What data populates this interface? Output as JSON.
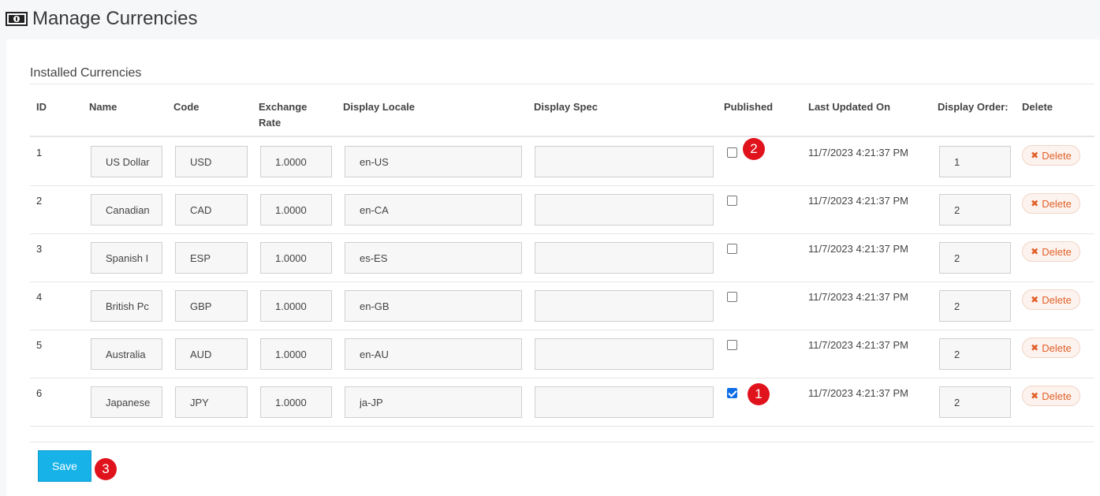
{
  "header": {
    "title": "Manage Currencies",
    "icon": "money-bill-icon"
  },
  "section": {
    "title": "Installed Currencies"
  },
  "columns": {
    "id": "ID",
    "name": "Name",
    "code": "Code",
    "rate_line1": "Exchange",
    "rate_line2": "Rate",
    "locale": "Display Locale",
    "spec": "Display Spec",
    "published": "Published",
    "updated": "Last Updated On",
    "order": "Display Order:",
    "delete": "Delete"
  },
  "rows": [
    {
      "id": "1",
      "name": "US Dollar",
      "code": "USD",
      "rate": "1.0000",
      "locale": "en-US",
      "spec": "",
      "published": false,
      "updated": "11/7/2023 4:21:37 PM",
      "order": "1",
      "delete_label": "Delete"
    },
    {
      "id": "2",
      "name": "Canadian",
      "code": "CAD",
      "rate": "1.0000",
      "locale": "en-CA",
      "spec": "",
      "published": false,
      "updated": "11/7/2023 4:21:37 PM",
      "order": "2",
      "delete_label": "Delete"
    },
    {
      "id": "3",
      "name": "Spanish I",
      "code": "ESP",
      "rate": "1.0000",
      "locale": "es-ES",
      "spec": "",
      "published": false,
      "updated": "11/7/2023 4:21:37 PM",
      "order": "2",
      "delete_label": "Delete"
    },
    {
      "id": "4",
      "name": "British Pc",
      "code": "GBP",
      "rate": "1.0000",
      "locale": "en-GB",
      "spec": "",
      "published": false,
      "updated": "11/7/2023 4:21:37 PM",
      "order": "2",
      "delete_label": "Delete"
    },
    {
      "id": "5",
      "name": "Australia",
      "code": "AUD",
      "rate": "1.0000",
      "locale": "en-AU",
      "spec": "",
      "published": false,
      "updated": "11/7/2023 4:21:37 PM",
      "order": "2",
      "delete_label": "Delete"
    },
    {
      "id": "6",
      "name": "Japanese",
      "code": "JPY",
      "rate": "1.0000",
      "locale": "ja-JP",
      "spec": "",
      "published": true,
      "updated": "11/7/2023 4:21:37 PM",
      "order": "2",
      "delete_label": "Delete"
    }
  ],
  "actions": {
    "save_label": "Save"
  },
  "annotations": {
    "badge_1": "1",
    "badge_2": "2",
    "badge_3": "3"
  },
  "colors": {
    "save": "#16b2e8",
    "delete_text": "#e0602a",
    "badge": "#e0121b",
    "checked": "#0d6ee6"
  }
}
